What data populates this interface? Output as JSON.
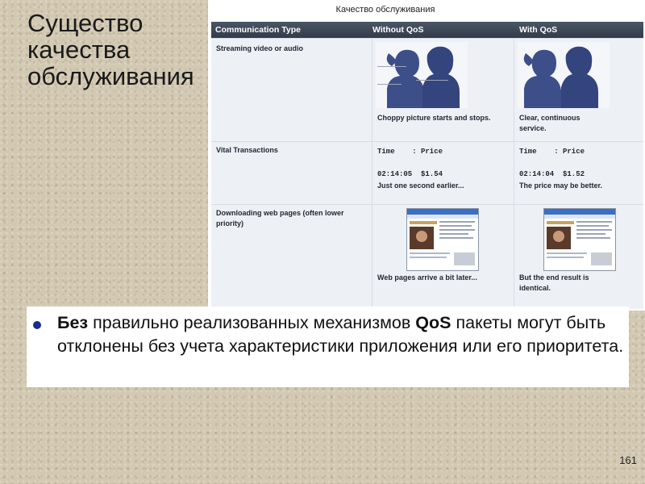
{
  "slide": {
    "title": "Существо качества обслуживания",
    "page_number": "161"
  },
  "table": {
    "caption": "Качество обслуживания",
    "headers": [
      "Communication Type",
      "Without QoS",
      "With QoS"
    ],
    "rows": [
      {
        "type": "Streaming video or audio",
        "without": {
          "line1": "Choppy picture starts and stops.",
          "line2": ""
        },
        "with": {
          "line1": "Clear, continuous",
          "line2": "service."
        }
      },
      {
        "type": "Vital Transactions",
        "without": {
          "label": "Time    : Price",
          "value": "02:14:05  $1.54",
          "note": "Just one second earlier..."
        },
        "with": {
          "label": "Time    : Price",
          "value": "02:14:04  $1.52",
          "note": "The price may be better."
        }
      },
      {
        "type_line1": "Downloading web pages (often lower",
        "type_line2": "priority)",
        "without": {
          "line1": "Web pages arrive a bit later...",
          "line2": ""
        },
        "with": {
          "line1": "But the end result is",
          "line2": "identical."
        }
      }
    ]
  },
  "bullet": {
    "bold_start": "Без",
    "text_1": " правильно реализованных механизмов ",
    "bold_mid": "QoS",
    "text_2": " пакеты могут быть отклонены без учета характеристики приложения или его приоритета."
  },
  "colors": {
    "header_bg": "#3a4555",
    "cell_bg": "#edf1f6",
    "bullet_color": "#1c2a8c",
    "face_color": "#3d4f88"
  }
}
